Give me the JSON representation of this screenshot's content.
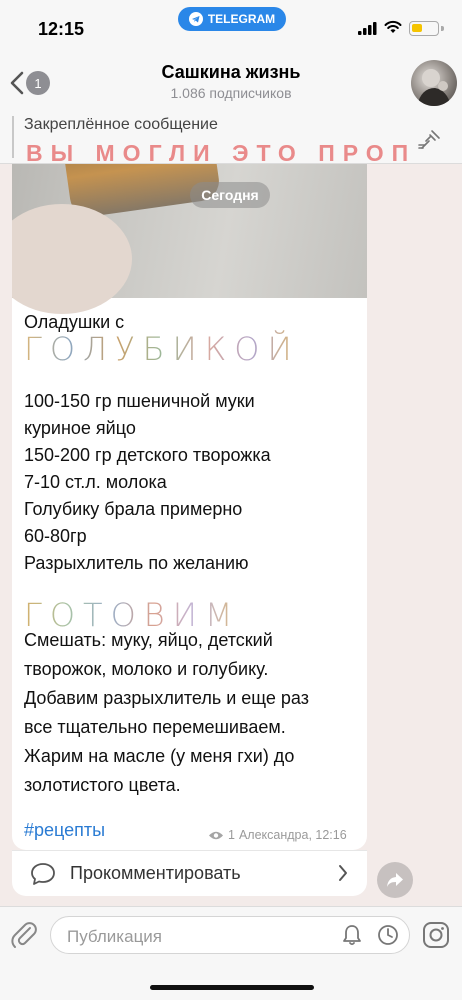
{
  "status": {
    "time": "12:15",
    "pill": "TELEGRAM"
  },
  "header": {
    "title": "Сашкина жизнь",
    "subtitle": "1.086 подписчиков",
    "back_badge": "1"
  },
  "pinned": {
    "label": "Закреплённое сообщение",
    "text": "ВЫ МОГЛИ ЭТО ПРОП..."
  },
  "chat": {
    "date_pill": "Сегодня"
  },
  "post": {
    "title": "Оладушки с",
    "title_deco": "ГОЛУБИКОЙ",
    "ingredients": [
      "100-150 гр пшеничной муки",
      "куриное яйцо",
      "150-200 гр детского творожка",
      "7-10 ст.л. молока",
      "Голубику брала примерно",
      "60-80гр",
      "Разрыхлитель по желанию"
    ],
    "section_deco": "ГОТОВИМ",
    "steps": [
      "Смешать: муку, яйцо, детский",
      "творожок, молоко и голубику.",
      "Добавим разрыхлитель  и еще раз",
      "все тщательно перемешиваем.",
      "Жарим на масле (у меня гхи) до",
      "золотистого цвета."
    ],
    "hashtag": "#рецепты",
    "views": "1",
    "author_time": "Александра, 12:16"
  },
  "comment": {
    "label": "Прокомментировать"
  },
  "composer": {
    "placeholder": "Публикация"
  },
  "colors": {
    "accent": "#2a87e8",
    "pin_text": "#e98a8a",
    "link": "#2a7bd3"
  }
}
